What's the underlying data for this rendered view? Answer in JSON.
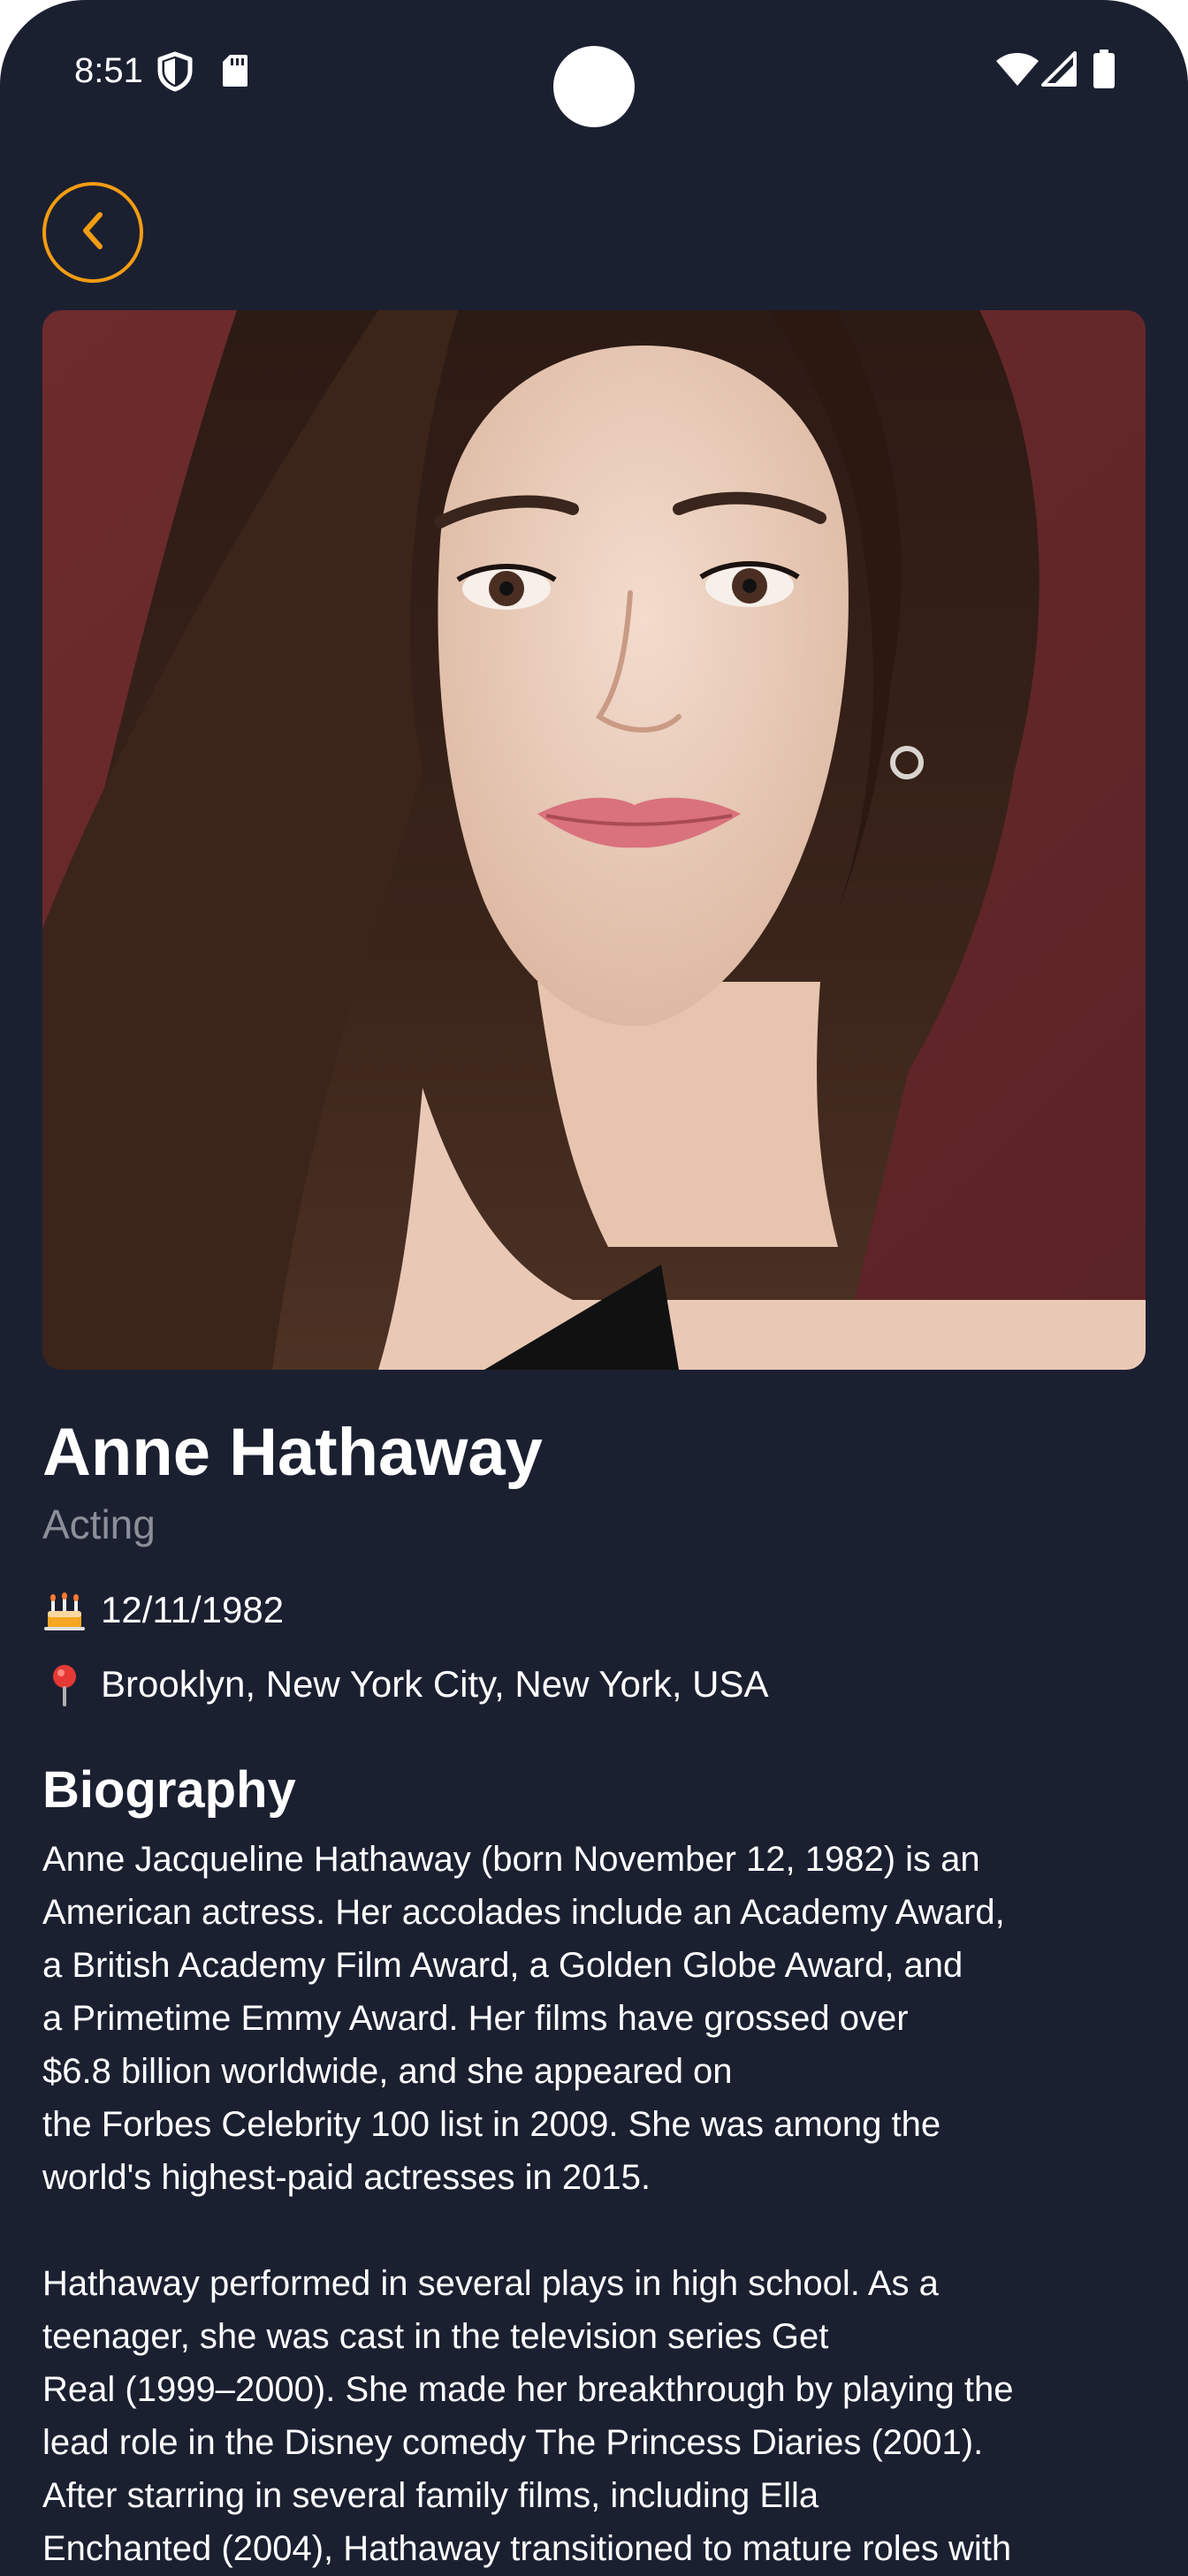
{
  "status_bar": {
    "time": "8:51",
    "icons": [
      "shield-icon",
      "sd-card-icon",
      "wifi-icon",
      "cellular-signal-icon",
      "battery-icon"
    ]
  },
  "nav": {
    "back_icon": "chevron-left-icon",
    "accent_color": "#f39c12"
  },
  "person": {
    "photo_alt": "Anne Hathaway",
    "name": "Anne Hathaway",
    "department": "Acting",
    "birthday_icon": "birthday-cake-icon",
    "birthday": "12/11/1982",
    "place_icon": "map-pin-icon",
    "place_of_birth": "Brooklyn, New York City, New York, USA"
  },
  "biography": {
    "title": "Biography",
    "text": "Anne Jacqueline Hathaway (born November 12, 1982) is an\nAmerican actress. Her accolades include an Academy Award,\na British Academy Film Award, a Golden Globe Award, and\na Primetime Emmy Award. Her films have grossed over\n$6.8 billion worldwide, and she appeared on\nthe Forbes Celebrity 100 list in 2009. She was among the\nworld's highest-paid actresses in 2015.\n\nHathaway performed in several plays in high school. As a\nteenager, she was cast in the television series Get\nReal (1999–2000). She made her breakthrough by playing the\nlead role in the Disney comedy The Princess Diaries (2001).\nAfter starring in several family films, including Ella\nEnchanted (2004), Hathaway transitioned to mature roles with"
  },
  "colors": {
    "background": "#1b2031",
    "secondary_text": "#8c8f99",
    "accent": "#f39c12"
  }
}
